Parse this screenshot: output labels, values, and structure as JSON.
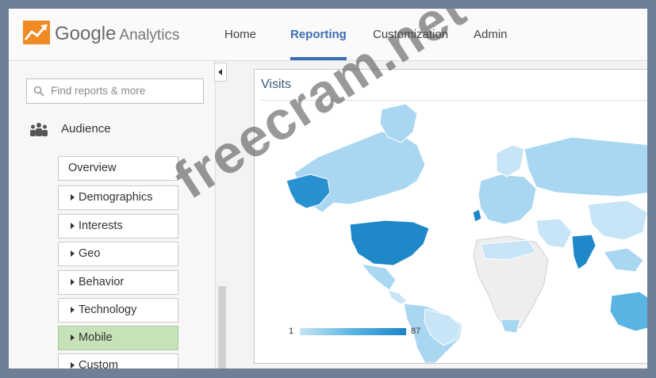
{
  "header": {
    "brand_name": "Google",
    "brand_product": "Analytics",
    "nav": [
      {
        "label": "Home",
        "active": false
      },
      {
        "label": "Reporting",
        "active": true
      },
      {
        "label": "Customization",
        "active": false
      },
      {
        "label": "Admin",
        "active": false
      }
    ],
    "accent_color": "#3c6db2"
  },
  "sidebar": {
    "search_placeholder": "Find reports & more",
    "section_icon": "audience-icon",
    "section_label": "Audience",
    "items": [
      {
        "label": "Overview",
        "expandable": false,
        "selected": false
      },
      {
        "label": "Demographics",
        "expandable": true,
        "selected": false
      },
      {
        "label": "Interests",
        "expandable": true,
        "selected": false
      },
      {
        "label": "Geo",
        "expandable": true,
        "selected": false
      },
      {
        "label": "Behavior",
        "expandable": true,
        "selected": false
      },
      {
        "label": "Technology",
        "expandable": true,
        "selected": false
      },
      {
        "label": "Mobile",
        "expandable": true,
        "selected": true
      },
      {
        "label": "Custom",
        "expandable": true,
        "selected": false
      }
    ],
    "selected_color": "#c7e2b9"
  },
  "panel": {
    "title": "Visits",
    "legend": {
      "min": "1",
      "max": "87",
      "color_low": "#c7e5f6",
      "color_high": "#1c84c6"
    }
  },
  "watermark": "freecram.net"
}
